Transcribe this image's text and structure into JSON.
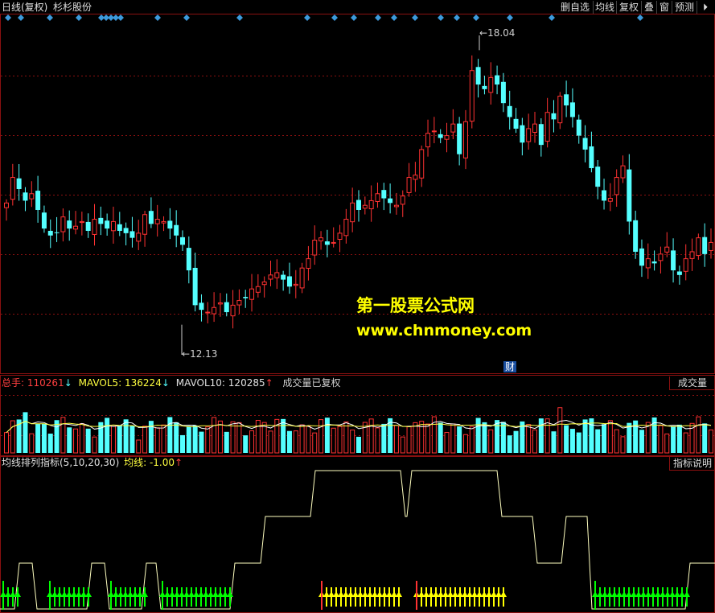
{
  "app": {
    "title_period": "日线(复权)",
    "stock_name": "杉杉股份"
  },
  "toolbar": [
    {
      "label": "删自选"
    },
    {
      "label": "均线"
    },
    {
      "label": "复权"
    },
    {
      "label": "叠"
    },
    {
      "label": "窗"
    },
    {
      "label": "预测"
    },
    {
      "label": "⏵"
    }
  ],
  "price_panel": {
    "high_label": "18.04",
    "low_label": "12.13",
    "watermark_cn": "第一股票公式网",
    "watermark_url": "www.chnmoney.com",
    "finance_marker": "财"
  },
  "volume_panel": {
    "total_label": "总手:",
    "total_value": "110261",
    "total_arrow": "↓",
    "mavol5_label": "MAVOL5:",
    "mavol5_value": "136224",
    "mavol5_arrow": "↓",
    "mavol10_label": "MAVOL10:",
    "mavol10_value": "120285",
    "mavol10_arrow": "↑",
    "note": "成交量已复权",
    "button": "成交量"
  },
  "indicator_panel": {
    "title": "均线排列指标(5,10,20,30)",
    "line_label": "均线:",
    "line_value": "-1.00",
    "line_arrow": "↑",
    "button": "指标说明"
  },
  "colors": {
    "up": "#ff3232",
    "down": "#54ffff",
    "grid": "#8a1010",
    "yellow": "#ffff00",
    "green": "#00ff00",
    "diamond": "#3c9adc"
  },
  "chart_data": {
    "type": "candlestick",
    "ylim": [
      11.5,
      18.6
    ],
    "price_high": 18.04,
    "price_low": 12.13,
    "close_series": [
      14.75,
      15.3,
      15.05,
      14.8,
      14.95,
      14.6,
      14.2,
      14.05,
      14.1,
      14.45,
      14.2,
      14.25,
      14.35,
      14.15,
      14.4,
      14.3,
      14.2,
      14.35,
      14.15,
      14.1,
      14.0,
      14.1,
      14.5,
      14.3,
      14.4,
      14.35,
      14.2,
      14.05,
      13.85,
      13.3,
      12.55,
      12.45,
      12.4,
      12.5,
      12.6,
      12.4,
      12.55,
      12.65,
      12.7,
      12.9,
      12.95,
      13.05,
      13.2,
      13.25,
      13.1,
      12.95,
      13.0,
      13.35,
      13.55,
      13.95,
      14.0,
      13.85,
      13.9,
      14.1,
      14.4,
      14.75,
      14.6,
      14.7,
      14.8,
      14.95,
      14.85,
      14.75,
      14.7,
      14.9,
      15.3,
      15.35,
      15.9,
      16.25,
      16.3,
      16.15,
      16.2,
      16.45,
      15.8,
      16.5,
      17.6,
      17.3,
      17.2,
      17.45,
      17.3,
      16.9,
      16.6,
      16.35,
      16.05,
      16.35,
      16.45,
      16.0,
      16.7,
      16.55,
      17.05,
      16.85,
      16.6,
      16.2,
      15.9,
      15.5,
      15.1,
      14.8,
      14.85,
      15.3,
      15.55,
      14.35,
      13.7,
      13.4,
      13.55,
      13.45,
      13.65,
      13.8,
      13.3,
      13.2,
      13.55,
      13.7,
      14.0,
      13.65,
      13.9
    ]
  }
}
